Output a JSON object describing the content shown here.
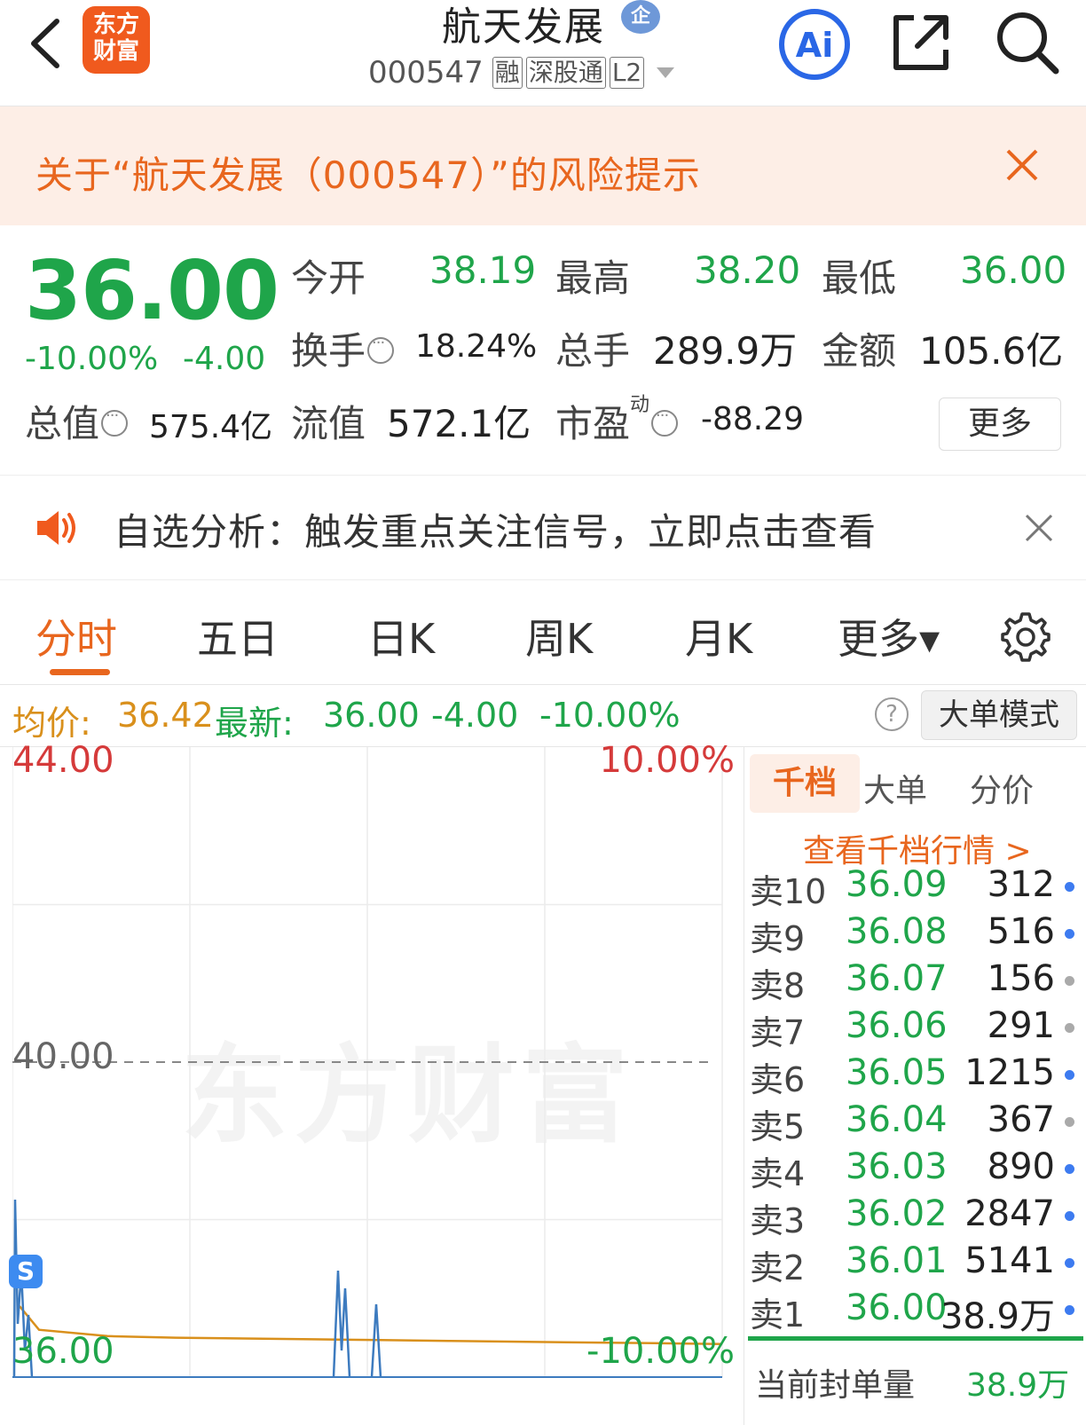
{
  "header": {
    "logo_line1": "东方",
    "logo_line2": "财富",
    "title": "航天发展",
    "ent_badge": "企",
    "code": "000547",
    "tags": [
      "融",
      "深股通",
      "L2"
    ]
  },
  "risk_banner": {
    "text": "关于“航天发展（000547）”的风险提示"
  },
  "quote": {
    "price": "36.00",
    "change_pct": "-10.00%",
    "change": "-4.00",
    "open_label": "今开",
    "open": "38.19",
    "high_label": "最高",
    "high": "38.20",
    "low_label": "最低",
    "low": "36.00",
    "turnover_label": "换手",
    "turnover": "18.24%",
    "volume_label": "总手",
    "volume": "289.9万",
    "amount_label": "金额",
    "amount": "105.6亿",
    "mktcap_label": "总值",
    "mktcap": "575.4亿",
    "float_label": "流值",
    "float": "572.1亿",
    "pe_label": "市盈",
    "pe_sup": "动",
    "pe": "-88.29",
    "more_label": "更多",
    "colors": {
      "down": "#1fa54a"
    }
  },
  "notice": {
    "text": "自选分析：触发重点关注信号，立即点击查看"
  },
  "tabs": [
    {
      "label": "分时"
    },
    {
      "label": "五日"
    },
    {
      "label": "日K"
    },
    {
      "label": "周K"
    },
    {
      "label": "月K"
    },
    {
      "label": "更多▾"
    }
  ],
  "infoline": {
    "avg_label": "均价:",
    "avg": "36.42",
    "latest_label": "最新:",
    "latest": "36.00",
    "change": "-4.00",
    "pct": "-10.00%",
    "help": "?",
    "bigorder_label": "大单模式"
  },
  "chart": {
    "y_top": "44.00",
    "pct_top": "10.00%",
    "y_mid": "40.00",
    "y_bottom": "36.00",
    "pct_bottom": "-10.00%",
    "watermark": "东方财富",
    "s_marker": "S"
  },
  "chart_data": {
    "type": "line",
    "ylim": [
      36.0,
      44.0
    ],
    "reference_price": 40.0,
    "series": [
      {
        "name": "均价",
        "color": "#d9901c",
        "values": [
          36.9,
          36.6,
          36.52,
          36.5,
          36.49,
          36.48,
          36.47,
          36.46,
          36.45,
          36.44,
          36.43,
          36.42
        ]
      }
    ],
    "volume_spikes": {
      "color": "#3d7bbf"
    }
  },
  "book": {
    "tabs": [
      "千档",
      "大单",
      "分价"
    ],
    "link": "查看千档行情 >",
    "rows": [
      {
        "label": "卖10",
        "price": "36.09",
        "vol": "312",
        "dot": "#3d7bf0"
      },
      {
        "label": "卖9",
        "price": "36.08",
        "vol": "516",
        "dot": "#3d7bf0"
      },
      {
        "label": "卖8",
        "price": "36.07",
        "vol": "156",
        "dot": "#aaaaaa"
      },
      {
        "label": "卖7",
        "price": "36.06",
        "vol": "291",
        "dot": "#aaaaaa"
      },
      {
        "label": "卖6",
        "price": "36.05",
        "vol": "1215",
        "dot": "#3d7bf0"
      },
      {
        "label": "卖5",
        "price": "36.04",
        "vol": "367",
        "dot": "#aaaaaa"
      },
      {
        "label": "卖4",
        "price": "36.03",
        "vol": "890",
        "dot": "#3d7bf0"
      },
      {
        "label": "卖3",
        "price": "36.02",
        "vol": "2847",
        "dot": "#3d7bf0"
      },
      {
        "label": "卖2",
        "price": "36.01",
        "vol": "5141",
        "dot": "#3d7bf0"
      },
      {
        "label": "卖1",
        "price": "36.00",
        "vol": "38.9万",
        "dot": "#3d7bf0"
      }
    ],
    "seal_label": "当前封单量",
    "seal_value": "38.9万"
  }
}
